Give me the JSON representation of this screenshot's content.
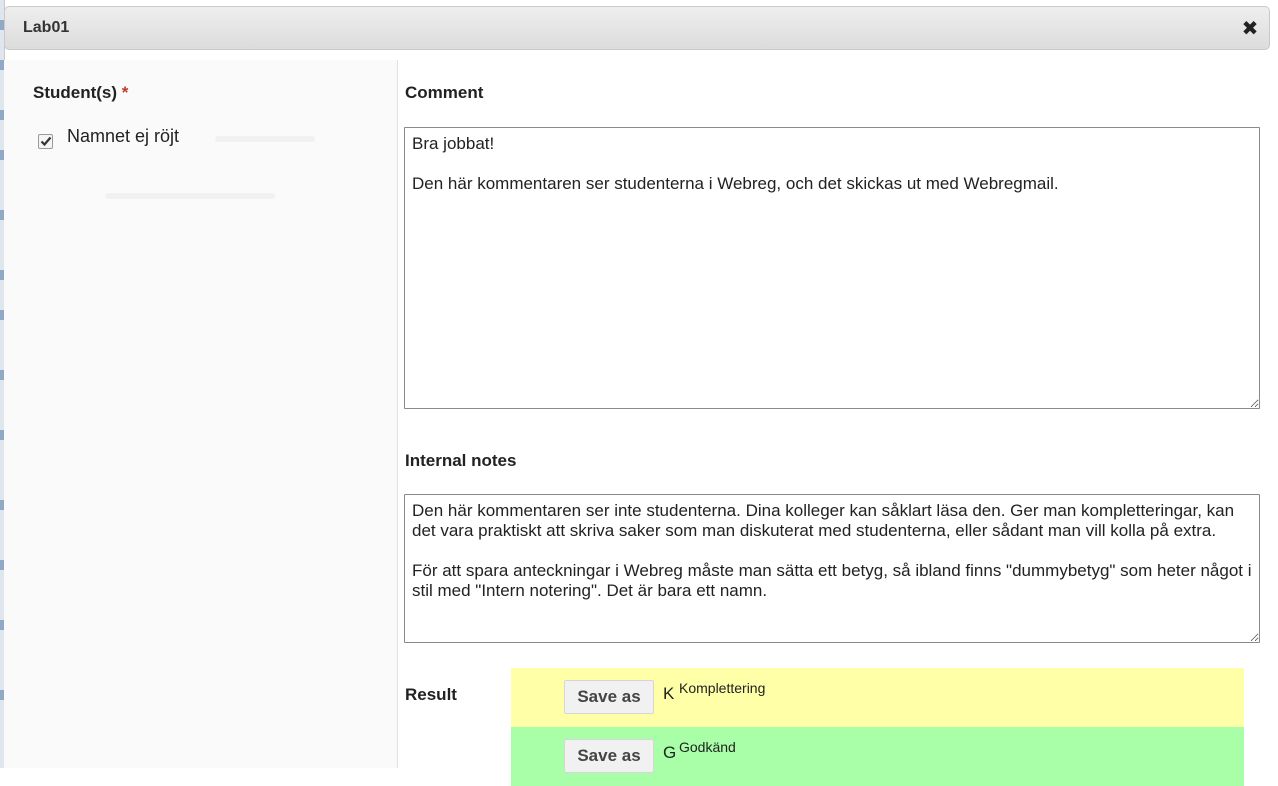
{
  "dialog": {
    "title": "Lab01",
    "close_icon": "close-icon"
  },
  "students": {
    "label": "Student(s)",
    "required_mark": "*",
    "items": [
      {
        "name": "Namnet ej röjt",
        "checked": true
      }
    ]
  },
  "comment": {
    "label": "Comment",
    "value": "Bra jobbat!\n\nDen här kommentaren ser studenterna i Webreg, och det skickas ut med Webregmail."
  },
  "internal_notes": {
    "label": "Internal notes",
    "value": "Den här kommentaren ser inte studenterna. Dina kolleger kan såklart läsa den. Ger man kompletteringar, kan det vara praktiskt att skriva saker som man diskuterat med studenterna, eller sådant man vill kolla på extra.\n\nFör att spara anteckningar i Webreg måste man sätta ett betyg, så ibland finns \"dummybetyg\" som heter något i stil med \"Intern notering\". Det är bara ett namn."
  },
  "result": {
    "label": "Result",
    "options": [
      {
        "button_label": "Save as",
        "grade": "K",
        "grade_name": "Komplettering",
        "color": "#ffffa8"
      },
      {
        "button_label": "Save as",
        "grade": "G",
        "grade_name": "Godkänd",
        "color": "#a8ffa8"
      }
    ]
  }
}
